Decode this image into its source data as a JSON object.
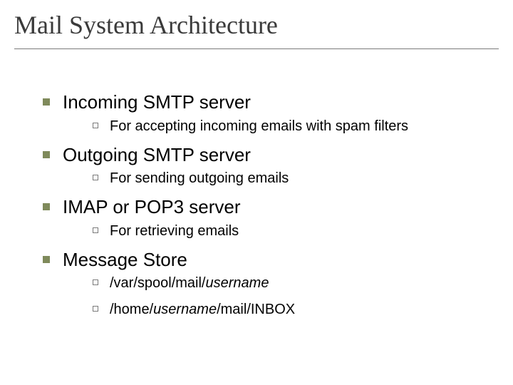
{
  "title": "Mail System Architecture",
  "items": [
    {
      "label": "Incoming SMTP server",
      "sub": [
        {
          "text": "For accepting incoming emails with spam filters"
        }
      ]
    },
    {
      "label": "Outgoing SMTP server",
      "sub": [
        {
          "text": "For sending outgoing emails"
        }
      ]
    },
    {
      "label": "IMAP or POP3 server",
      "sub": [
        {
          "text": "For retrieving emails"
        }
      ]
    },
    {
      "label": "Message Store",
      "sub": [
        {
          "pre": "/var/spool/mail/",
          "em": "username",
          "post": ""
        },
        {
          "pre": "/home/",
          "em": "username",
          "post": "/mail/INBOX"
        }
      ]
    }
  ]
}
